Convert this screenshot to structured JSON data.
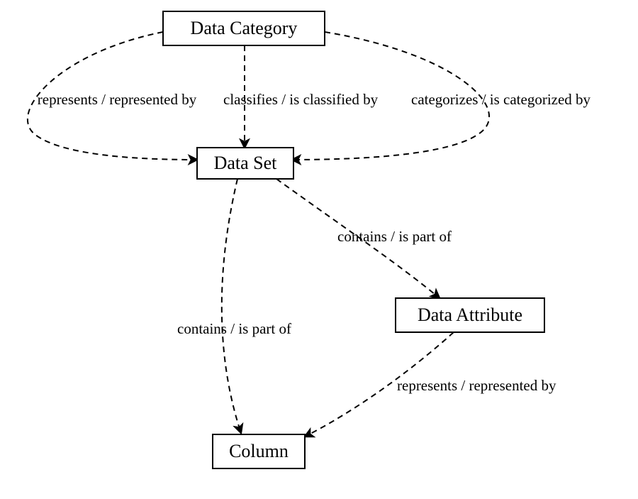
{
  "diagram": {
    "nodes": {
      "dataCategory": {
        "label": "Data Category"
      },
      "dataSet": {
        "label": "Data Set"
      },
      "dataAttribute": {
        "label": "Data Attribute"
      },
      "column": {
        "label": "Column"
      }
    },
    "edges": {
      "represents_cat_set": {
        "label": "represents / represented by"
      },
      "classifies_cat_set": {
        "label": "classifies / is classified by"
      },
      "categorizes_cat_set": {
        "label": "categorizes / is categorized by"
      },
      "contains_set_attr": {
        "label": "contains / is part of"
      },
      "contains_set_col": {
        "label": "contains / is part of"
      },
      "represents_attr_col": {
        "label": "represents / represented by"
      }
    }
  }
}
